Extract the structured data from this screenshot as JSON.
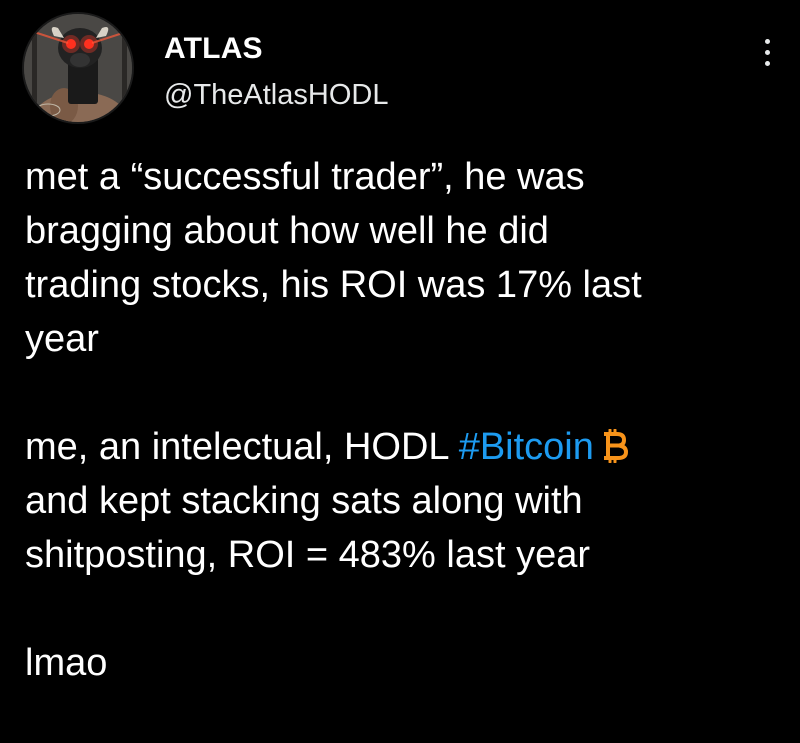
{
  "user": {
    "display_name": "ATLAS",
    "handle": "@TheAtlasHODL",
    "avatar_icon": "profile-photo-icon"
  },
  "menu": {
    "icon": "more-options-icon"
  },
  "tweet": {
    "paragraph1_lines": [
      "met a “successful trader”, he was",
      "bragging about how well he did",
      "trading stocks, his ROI was 17% last",
      "year"
    ],
    "paragraph2_line1_before": "me, an intelectual, HODL ",
    "hashtag": "#Bitcoin",
    "paragraph2_lines_after": [
      "and kept stacking sats along with",
      "shitposting, ROI = 483% last year"
    ],
    "paragraph3": "lmao",
    "emoji_icon": "bitcoin-icon"
  },
  "colors": {
    "background": "#000000",
    "text": "#ffffff",
    "hashtag": "#1d9bf0",
    "bitcoin": "#f7931a"
  }
}
